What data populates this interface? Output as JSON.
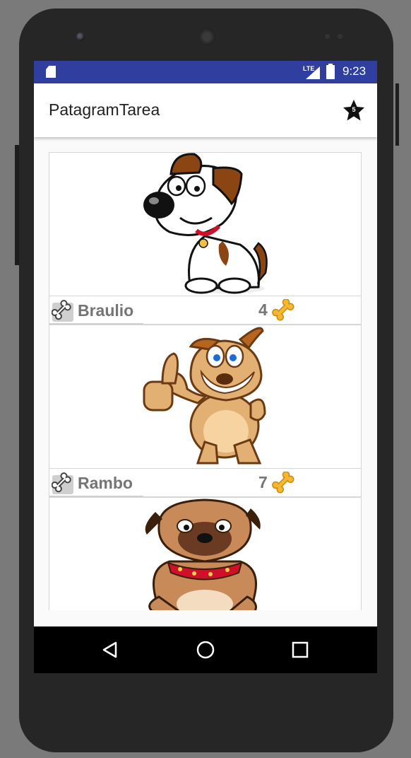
{
  "status_bar": {
    "network": "LTE",
    "time": "9:23"
  },
  "app_bar": {
    "title": "PatagramTarea",
    "favorites_count": "5",
    "favorites_icon": "star-icon"
  },
  "pets": [
    {
      "name": "Braulio",
      "rating": "4",
      "image": "cartoon-dog-white-brown"
    },
    {
      "name": "Rambo",
      "rating": "7",
      "image": "cartoon-dog-thumbs-up"
    },
    {
      "name": "",
      "rating": "",
      "image": "cartoon-pug-red-collar"
    }
  ],
  "nav_bar": {
    "back_icon": "back-triangle-icon",
    "home_icon": "home-circle-icon",
    "recents_icon": "recents-square-icon"
  },
  "colors": {
    "status_bar": "#303f9f",
    "app_bar": "#ffffff",
    "text_gray": "#757575",
    "bone_gold": "#f5b82e"
  }
}
